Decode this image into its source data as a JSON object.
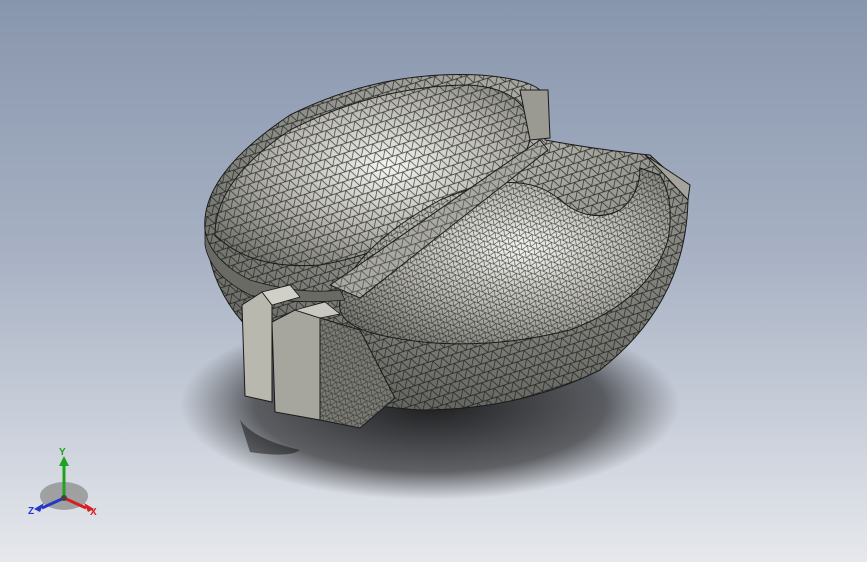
{
  "viewport": {
    "background_top": "#8896ad",
    "background_bottom": "#e6e8ec",
    "model": {
      "display_style": "shaded-with-edges",
      "fill_color": "#8a8a83",
      "edge_color": "#1a1a1a",
      "shadow": true
    }
  },
  "triad": {
    "x_label": "X",
    "y_label": "Y",
    "z_label": "Z",
    "x_color": "#d42020",
    "y_color": "#1fa31f",
    "z_color": "#2438c8"
  }
}
